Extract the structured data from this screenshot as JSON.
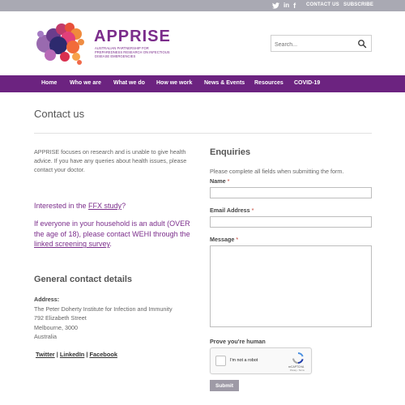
{
  "topbar": {
    "social": [
      {
        "icon": "twitter-icon",
        "glyph": "🐦"
      },
      {
        "icon": "linkedin-icon",
        "glyph": "in"
      },
      {
        "icon": "facebook-icon",
        "glyph": "f"
      }
    ],
    "contact_label": "CONTACT US",
    "subscribe_label": "SUBSCRIBE"
  },
  "header": {
    "brand": "APPRISE",
    "tagline": "Australian Partnership for Preparedness Research on Infectious Disease Emergencies",
    "search_placeholder": "Search..."
  },
  "nav": {
    "items": [
      "Home",
      "Who we are",
      "What we do",
      "How we work",
      "News & Events",
      "Resources",
      "COVID-19"
    ]
  },
  "page": {
    "title": "Contact us"
  },
  "left": {
    "intro": "APPRISE focuses on research and is unable to give health advice. If you have any queries about health issues, please contact your doctor.",
    "ffx_prefix": "Interested in the ",
    "ffx_link": "FFX study",
    "ffx_suffix": "?",
    "screening_text": "If everyone in your household is an adult (OVER the age of 18), please contact WEHI through the ",
    "screening_link": "linked screening survey",
    "screening_suffix": ".",
    "general_heading": "General contact details",
    "address_label": "Address:",
    "address_lines": [
      "The Peter Doherty Institute for Infection and Immunity",
      "792 Elizabeth Street",
      "Melbourne, 3000",
      "Australia"
    ],
    "social_links": [
      "Twitter",
      "LinkedIn",
      "Facebook"
    ],
    "separator": " | "
  },
  "form": {
    "heading": "Enquiries",
    "note": "Please complete all fields when submitting the form.",
    "name_label": "Name",
    "email_label": "Email Address",
    "message_label": "Message",
    "required_mark": "*",
    "human_label": "Prove you're human",
    "captcha_label": "I'm not a robot",
    "captcha_brand": "reCAPTCHA",
    "captcha_terms": "Privacy - Terms",
    "submit_label": "Submit"
  },
  "colors": {
    "brand_purple": "#7b2d8b",
    "nav_bg": "#6c2380",
    "topbar_bg": "#a9a9b3",
    "submit_bg": "#9e9aa6"
  }
}
